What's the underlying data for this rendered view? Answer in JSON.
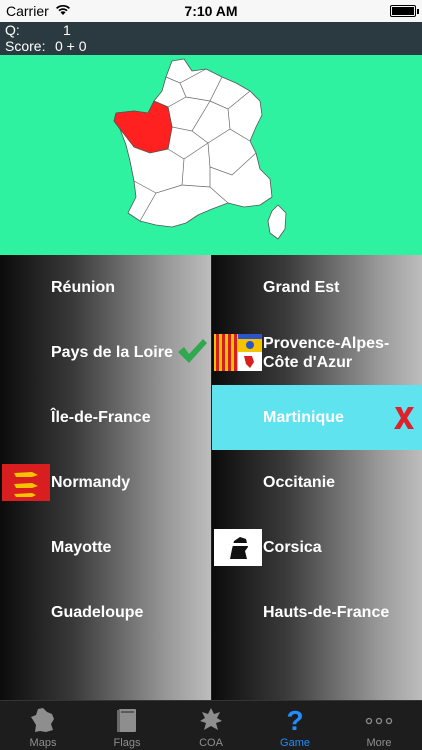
{
  "status_bar": {
    "carrier": "Carrier",
    "time": "7:10 AM"
  },
  "info": {
    "question_label": "Q:",
    "question_value": "1",
    "score_label": "Score:",
    "score_value": "0 + 0"
  },
  "map": {
    "background_color": "#2ef2a0",
    "highlight_color": "#ff2020",
    "highlighted_region": "Pays de la Loire"
  },
  "answers": {
    "left": [
      {
        "label": "Réunion",
        "state": "normal"
      },
      {
        "label": "Pays de la Loire",
        "state": "correct",
        "mark": "check-icon"
      },
      {
        "label": "Île-de-France",
        "state": "normal"
      },
      {
        "label": "Normandy",
        "state": "normal",
        "badge": "normandy-flag-icon"
      },
      {
        "label": "Mayotte",
        "state": "normal"
      },
      {
        "label": "Guadeloupe",
        "state": "normal"
      }
    ],
    "right": [
      {
        "label": "Grand Est",
        "state": "normal"
      },
      {
        "label": "Provence-Alpes-Côte d'Azur",
        "state": "normal",
        "badge": "provence-flag-icon"
      },
      {
        "label": "Martinique",
        "state": "wrong",
        "mark": "x-icon"
      },
      {
        "label": "Occitanie",
        "state": "normal"
      },
      {
        "label": "Corsica",
        "state": "normal",
        "badge": "corsica-flag-icon"
      },
      {
        "label": "Hauts-de-France",
        "state": "normal"
      }
    ],
    "wrong_color": "#5ee3ef",
    "check_color": "#2fa84f",
    "x_color": "#e0202a"
  },
  "tabs": [
    {
      "label": "Maps",
      "icon": "france-map-icon",
      "active": false
    },
    {
      "label": "Flags",
      "icon": "book-icon",
      "active": false
    },
    {
      "label": "COA",
      "icon": "coat-of-arms-icon",
      "active": false
    },
    {
      "label": "Game",
      "icon": "question-mark-icon",
      "active": true
    },
    {
      "label": "More",
      "icon": "more-dots-icon",
      "active": false
    }
  ],
  "tab_active_color": "#1f8cff"
}
